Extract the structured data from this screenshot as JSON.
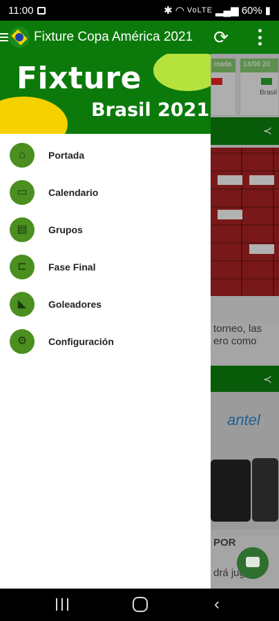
{
  "status_bar": {
    "time": "11:00",
    "signal_text": "VoLTE",
    "battery": "60%"
  },
  "app_bar": {
    "title": "Fixture Copa América 2021",
    "refresh_icon": "refresh-icon",
    "more_icon": "more-vert-icon",
    "menu_icon": "hamburger-icon"
  },
  "drawer": {
    "header_title": "Fixture",
    "header_subtitle": "Brasil 2021",
    "items": [
      {
        "label": "Portada",
        "icon": "home-icon"
      },
      {
        "label": "Calendario",
        "icon": "calendar-icon"
      },
      {
        "label": "Grupos",
        "icon": "groups-icon"
      },
      {
        "label": "Fase Final",
        "icon": "bracket-icon"
      },
      {
        "label": "Goleadores",
        "icon": "shoe-icon"
      },
      {
        "label": "Configuración",
        "icon": "gear-icon"
      }
    ]
  },
  "background": {
    "match_1_header": "mada",
    "match_2_header": "14/06 20",
    "match_2_team": "Brasil",
    "text_1_line_1": "torneo, las",
    "text_1_line_2": "ero como",
    "photo_2_brand": "antel",
    "text_2_line_1": "POR",
    "text_2_line_2": "drá jugar"
  },
  "colors": {
    "primary_green": "#0b7a0b",
    "icon_green": "#4a8f1f",
    "accent_yellow": "#f5d100",
    "accent_lime": "#b6e23e"
  }
}
